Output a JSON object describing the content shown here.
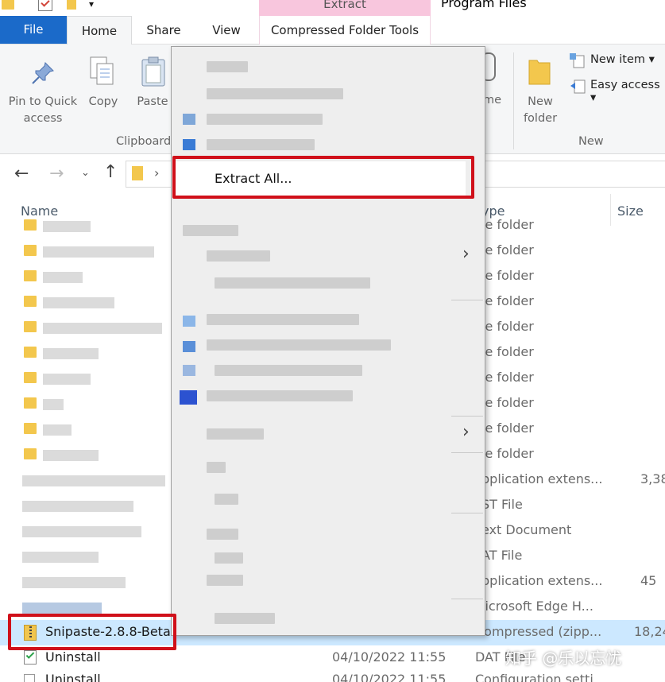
{
  "titlebar": {
    "context_tab": "Extract",
    "window_title": "Program Files",
    "qa_more": "▾"
  },
  "tabs": {
    "file": "File",
    "home": "Home",
    "share": "Share",
    "view": "View",
    "compressed": "Compressed Folder Tools"
  },
  "ribbon": {
    "pin_line1": "Pin to Quick",
    "pin_line2": "access",
    "copy": "Copy",
    "paste": "Paste",
    "clipboard_group": "Clipboard",
    "rename_fragment": "me",
    "new_folder_line1": "New",
    "new_folder_line2": "folder",
    "new_item": "New item ▾",
    "easy_access": "Easy access ▾",
    "new_group": "New"
  },
  "nav": {
    "back": "←",
    "forward": "→",
    "recent": "⌄",
    "up": "↑",
    "chevron": "›"
  },
  "columns": {
    "name": "Name",
    "type": "ype",
    "size": "Size"
  },
  "rows": [
    {
      "type": "le folder"
    },
    {
      "type": "le folder"
    },
    {
      "type": "le folder"
    },
    {
      "type": "le folder"
    },
    {
      "type": "le folder"
    },
    {
      "type": "le folder"
    },
    {
      "type": "le folder"
    },
    {
      "type": "le folder"
    },
    {
      "type": "le folder"
    },
    {
      "type": "le folder"
    },
    {
      "type": "pplication extens...",
      "size": "3,38"
    },
    {
      "type": "ST File"
    },
    {
      "type": "ext Document"
    },
    {
      "type": "AT File"
    },
    {
      "type": "pplication extens...",
      "size": "45"
    },
    {
      "type": "licrosoft Edge H..."
    }
  ],
  "selected_row": {
    "name": "Snipaste-2.8.8-Beta-",
    "type": "Compressed (zipp...",
    "size": "18,24"
  },
  "uninstall_row": {
    "name": "Uninstall",
    "date": "04/10/2022 11:55",
    "type": "DAT File"
  },
  "uninstall_row2": {
    "name": "Uninstall",
    "date": "04/10/2022 11:55",
    "type": "Configuration setti"
  },
  "context_menu": {
    "extract_all": "Extract All...",
    "submenu_arrow": "›"
  },
  "watermark": "知乎 @乐以忘忧",
  "colors": {
    "highlight": "#d0101a",
    "file_tab": "#1b6ac9",
    "selected_row": "#cce8ff",
    "context_tab": "#f8c6dd",
    "folder": "#f3c74d"
  }
}
